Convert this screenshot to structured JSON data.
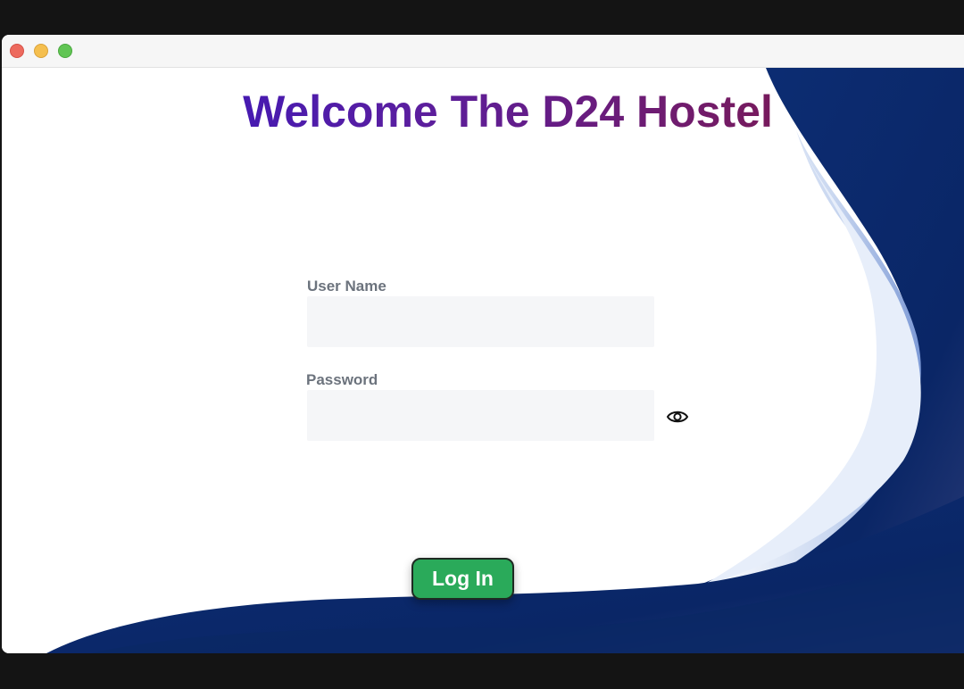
{
  "window": {
    "controls": [
      "close-button",
      "minimize-button",
      "maximize-button"
    ]
  },
  "page": {
    "title": "Welcome The D24 Hostel"
  },
  "form": {
    "username_label": "User Name",
    "username_value": "",
    "password_label": "Password",
    "password_value": "",
    "toggle_icon": "eye-icon",
    "login_label": "Log In"
  },
  "colors": {
    "title_gradient_start": "#2a14c9",
    "title_gradient_end": "#8c1630",
    "button": "#2aaa5a",
    "wave_dark": "#0c2a6b",
    "wave_light": "#c9d7f0"
  }
}
